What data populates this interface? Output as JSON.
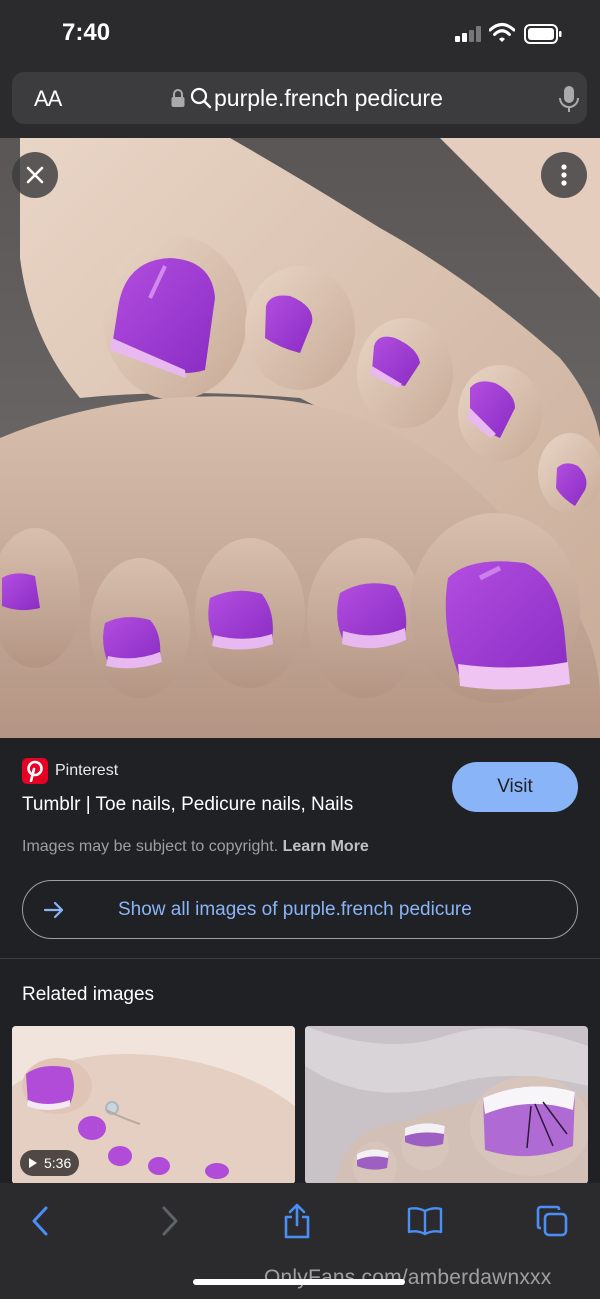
{
  "status_bar": {
    "time": "7:40"
  },
  "url_bar": {
    "text_size_label": "AA",
    "query": "purple.french pedicure"
  },
  "image_viewer": {
    "close_icon": "close-icon",
    "more_icon": "more-vertical-icon"
  },
  "result": {
    "source": "Pinterest",
    "title": "Tumblr | Toe nails, Pedicure nails, Nails",
    "visit_label": "Visit",
    "copyright_text": "Images may be subject to copyright.",
    "learn_more": "Learn More",
    "show_all_label": "Show all images of purple.french pedicure"
  },
  "related": {
    "title": "Related images",
    "items": [
      {
        "duration": "5:36"
      },
      {
        "duration": ""
      }
    ]
  },
  "toolbar": {
    "buttons": [
      "back-icon",
      "forward-icon",
      "share-icon",
      "bookmarks-icon",
      "tabs-icon"
    ]
  },
  "watermark": "OnlyFans.com/amberdawnxxx",
  "colors": {
    "accent": "#8ab4f8",
    "pinterest": "#e60023",
    "polish": "#a63fd6"
  }
}
